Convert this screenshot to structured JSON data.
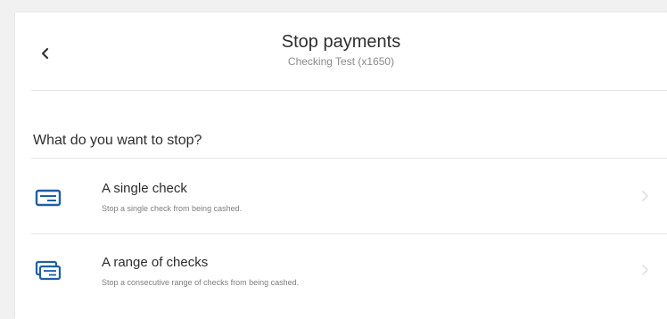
{
  "header": {
    "back_icon": "chevron-left-icon",
    "title": "Stop payments",
    "subtitle": "Checking Test (x1650)"
  },
  "prompt": {
    "question": "What do you want to stop?"
  },
  "options": [
    {
      "title": "A single check",
      "description": "Stop a single check from being cashed.",
      "icon": "single-check-icon"
    },
    {
      "title": "A range of checks",
      "description": "Stop a consecutive range of checks from being cashed.",
      "icon": "check-range-icon"
    }
  ],
  "colors": {
    "accent": "#1f5fa6",
    "divider": "#e6e6e6",
    "background": "#f1f1f1"
  }
}
